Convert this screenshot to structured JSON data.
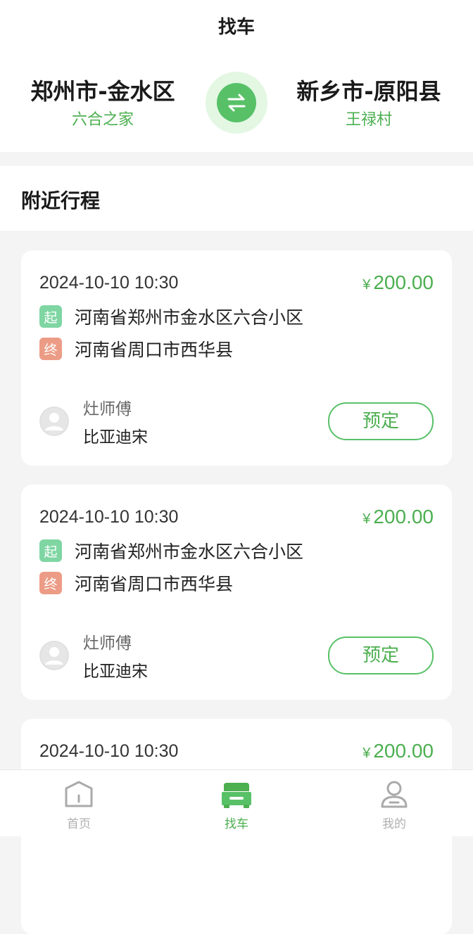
{
  "page": {
    "title": "找车"
  },
  "route": {
    "from": {
      "city": "郑州市-金水区",
      "spot": "六合之家"
    },
    "to": {
      "city": "新乡市-原阳县",
      "spot": "王禄村"
    }
  },
  "nearby": {
    "title": "附近行程"
  },
  "trips": [
    {
      "time": "2024-10-10 10:30",
      "currency": "¥",
      "price": "200.00",
      "start_tag": "起",
      "start": "河南省郑州市金水区六合小区",
      "end_tag": "终",
      "end": "河南省周口市西华县",
      "driver": "灶师傅",
      "car": "比亚迪宋",
      "action": "预定"
    },
    {
      "time": "2024-10-10 10:30",
      "currency": "¥",
      "price": "200.00",
      "start_tag": "起",
      "start": "河南省郑州市金水区六合小区",
      "end_tag": "终",
      "end": "河南省周口市西华县",
      "driver": "灶师傅",
      "car": "比亚迪宋",
      "action": "预定"
    },
    {
      "time": "2024-10-10 10:30",
      "currency": "¥",
      "price": "200.00"
    }
  ],
  "tabbar": {
    "items": [
      {
        "label": "首页",
        "icon": "home-icon"
      },
      {
        "label": "找车",
        "icon": "car-icon"
      },
      {
        "label": "我的",
        "icon": "user-icon"
      }
    ],
    "active": 1
  },
  "colors": {
    "accent": "#4caf50",
    "start_tag": "#7fd6a3",
    "end_tag": "#ec9c86",
    "background": "#f4f4f4"
  }
}
